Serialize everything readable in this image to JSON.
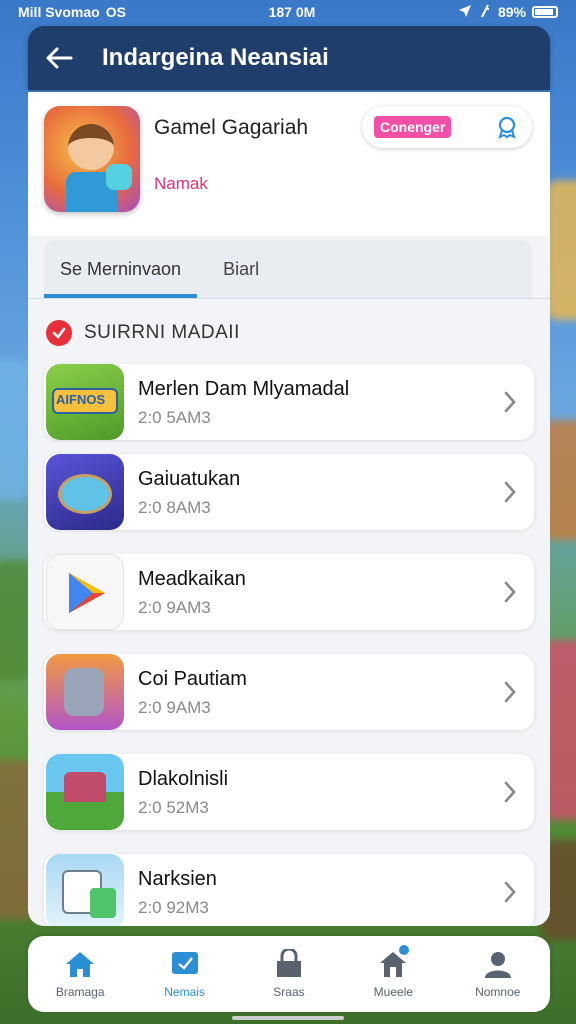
{
  "status_bar": {
    "carrier": "Mill Svomao",
    "network": "OS",
    "time": "187 0M",
    "battery": "89%"
  },
  "header": {
    "title": "Indargeina Neansiai"
  },
  "game": {
    "title": "Gamel Gagariah",
    "subtitle": "Namak",
    "action_label": "Conenger"
  },
  "tabs": [
    {
      "label": "Se Merninvaon",
      "active": true
    },
    {
      "label": "Biarl",
      "active": false
    }
  ],
  "section": {
    "title": "SUIRRNI MADAII"
  },
  "items": [
    {
      "name": "Merlen Dam Mlyamadal",
      "meta": "2:0 5AM3"
    },
    {
      "name": "Gaiuatukan",
      "meta": "2:0 8AM3"
    },
    {
      "name": "Meadkaikan",
      "meta": "2:0 9AM3"
    },
    {
      "name": "Coi Pautiam",
      "meta": "2:0 9AM3"
    },
    {
      "name": "Dlakolnisli",
      "meta": "2:0 52M3"
    },
    {
      "name": "Narksien",
      "meta": "2:0 92M3"
    }
  ],
  "icon1_text": "AIFNOS",
  "nav": [
    {
      "label": "Bramaga",
      "icon": "home-icon",
      "active": false
    },
    {
      "label": "Nemais",
      "icon": "messages-icon",
      "active": true
    },
    {
      "label": "Sraas",
      "icon": "store-icon",
      "active": false
    },
    {
      "label": "Mueele",
      "icon": "house-notification-icon",
      "active": false
    },
    {
      "label": "Nomnoe",
      "icon": "profile-icon",
      "active": false
    }
  ],
  "colors": {
    "accent": "#2b8fd6",
    "header_bg": "#1f3e6b",
    "pink": "#f24fa6",
    "subtitle": "#e0307a",
    "check_red": "#e8303a"
  }
}
